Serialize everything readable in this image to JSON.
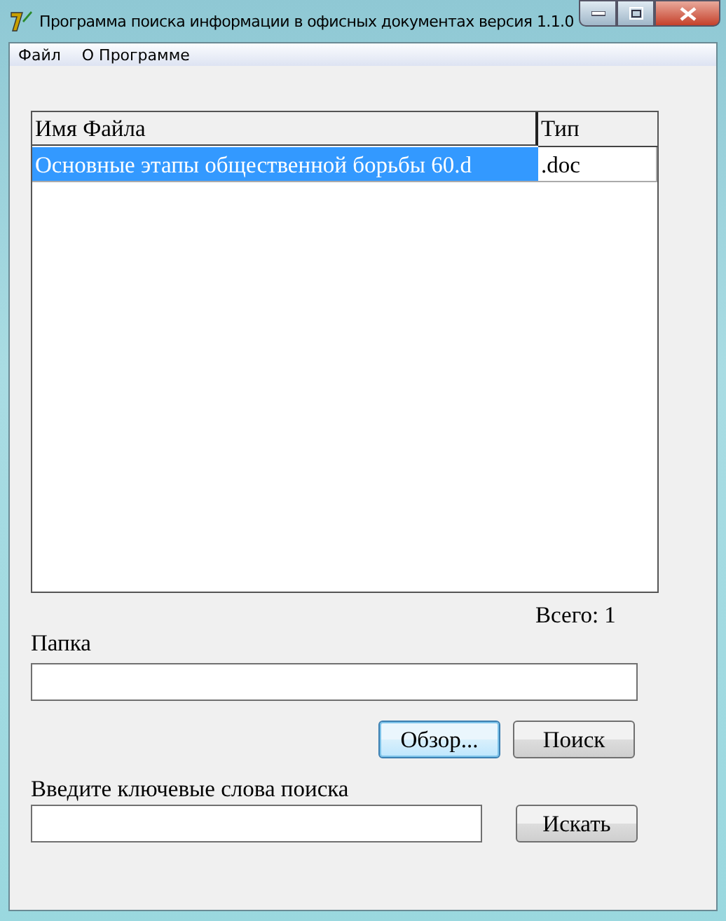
{
  "window": {
    "title": "Программа поиска информации в офисных документах версия 1.1.0"
  },
  "menu": [
    {
      "label": "Файл"
    },
    {
      "label": "О Программе"
    }
  ],
  "table": {
    "columns": [
      "Имя Файла",
      "Тип"
    ],
    "rows": [
      {
        "cells": [
          "Основные этапы общественной борьбы 60.d",
          ".doc"
        ],
        "selected": true
      }
    ]
  },
  "total": "Всего: 1",
  "folder": {
    "label": "Папка"
  },
  "folder_buttons": [
    {
      "label": "Обзор...",
      "focused": true
    },
    {
      "label": "Поиск",
      "focused": false
    }
  ],
  "keywords": {
    "label": "Введите ключевые слова поиска"
  },
  "search_button": {
    "label": "Искать",
    "focused": false
  }
}
